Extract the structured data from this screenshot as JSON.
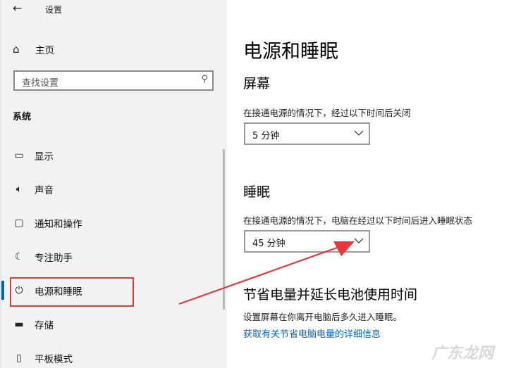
{
  "app_title": "设置",
  "sidebar": {
    "home_label": "主页",
    "search_placeholder": "查找设置",
    "section_label": "系统",
    "items": [
      {
        "label": "显示",
        "icon": "monitor-icon"
      },
      {
        "label": "声音",
        "icon": "speaker-icon"
      },
      {
        "label": "通知和操作",
        "icon": "notification-icon"
      },
      {
        "label": "专注助手",
        "icon": "moon-icon"
      },
      {
        "label": "电源和睡眠",
        "icon": "power-icon"
      },
      {
        "label": "存储",
        "icon": "storage-icon"
      },
      {
        "label": "平板模式",
        "icon": "tablet-icon"
      }
    ],
    "selected_index": 4
  },
  "main": {
    "title": "电源和睡眠",
    "screen": {
      "heading": "屏幕",
      "description": "在接通电源的情况下，经过以下时间后关闭",
      "value": "5 分钟"
    },
    "sleep": {
      "heading": "睡眠",
      "description": "在接通电源的情况下，电脑在经过以下时间后进入睡眠状态",
      "value": "45 分钟"
    },
    "battery": {
      "heading": "节省电量并延长电池使用时间",
      "description": "设置屏幕在你离开电脑后多久进入睡眠。",
      "link": "获取有关节省电脑电量的详细信息"
    }
  },
  "watermark": "广东龙网",
  "colors": {
    "accent": "#0063b1",
    "annotation": "#e23a3a",
    "link": "#0066cc"
  }
}
